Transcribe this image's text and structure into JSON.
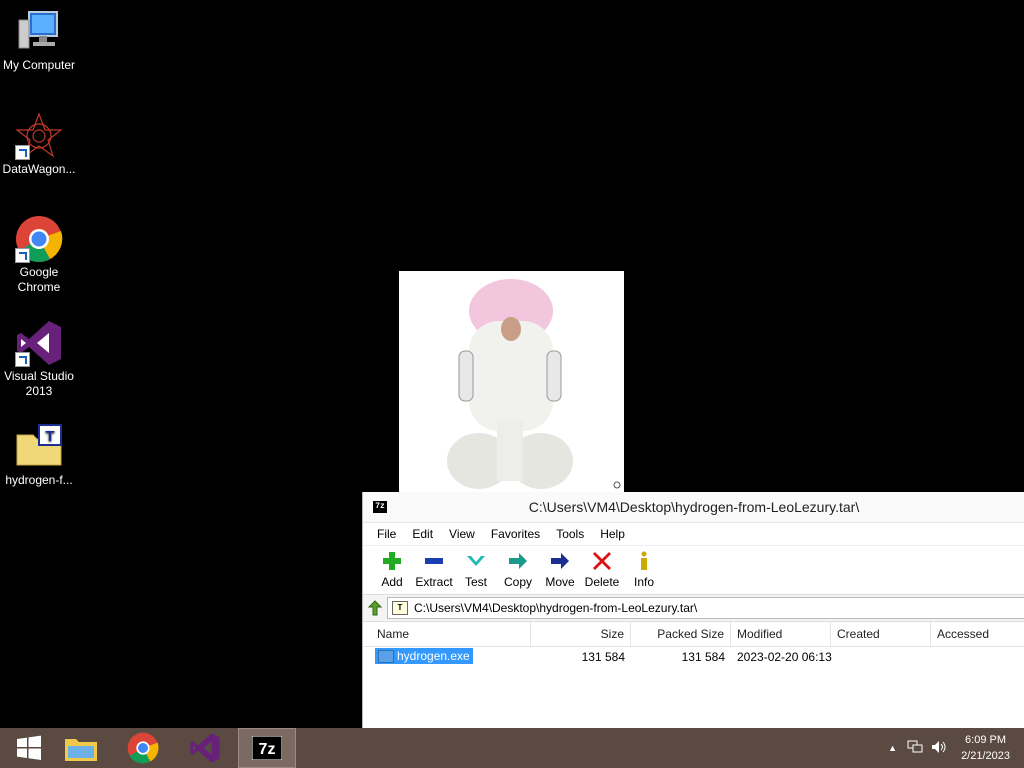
{
  "desktop": {
    "icons": [
      {
        "label": "My Computer",
        "icon": "my-computer-icon"
      },
      {
        "label": "DataWagon...",
        "icon": "datawagon-icon"
      },
      {
        "label": "Google Chrome",
        "icon": "chrome-icon"
      },
      {
        "label": "Visual Studio 2013",
        "icon": "visual-studio-icon"
      },
      {
        "label": "hydrogen-f...",
        "icon": "archive-file-icon"
      }
    ]
  },
  "window": {
    "title": "C:\\Users\\VM4\\Desktop\\hydrogen-from-LeoLezury.tar\\",
    "app_icon_text": "7z",
    "menu": [
      "File",
      "Edit",
      "View",
      "Favorites",
      "Tools",
      "Help"
    ],
    "toolbar": [
      {
        "label": "Add",
        "icon": "add-icon",
        "color": "#22aa22"
      },
      {
        "label": "Extract",
        "icon": "extract-icon",
        "color": "#1a3fb0"
      },
      {
        "label": "Test",
        "icon": "test-icon",
        "color": "#1fb7b7"
      },
      {
        "label": "Copy",
        "icon": "copy-icon",
        "color": "#1a9a8a"
      },
      {
        "label": "Move",
        "icon": "move-icon",
        "color": "#1a2f90"
      },
      {
        "label": "Delete",
        "icon": "delete-icon",
        "color": "#dd1111"
      },
      {
        "label": "Info",
        "icon": "info-icon",
        "color": "#ccaa00"
      }
    ],
    "address": "C:\\Users\\VM4\\Desktop\\hydrogen-from-LeoLezury.tar\\",
    "columns": [
      "Name",
      "Size",
      "Packed Size",
      "Modified",
      "Created",
      "Accessed"
    ],
    "rows": [
      {
        "name": "hydrogen.exe",
        "size": "131 584",
        "packed": "131 584",
        "modified": "2023-02-20 06:13",
        "created": "",
        "accessed": ""
      }
    ]
  },
  "taskbar": {
    "apps": [
      "start-button",
      "file-explorer",
      "chrome",
      "visual-studio",
      "7zip"
    ],
    "time": "6:09 PM",
    "date": "2/21/2023"
  }
}
